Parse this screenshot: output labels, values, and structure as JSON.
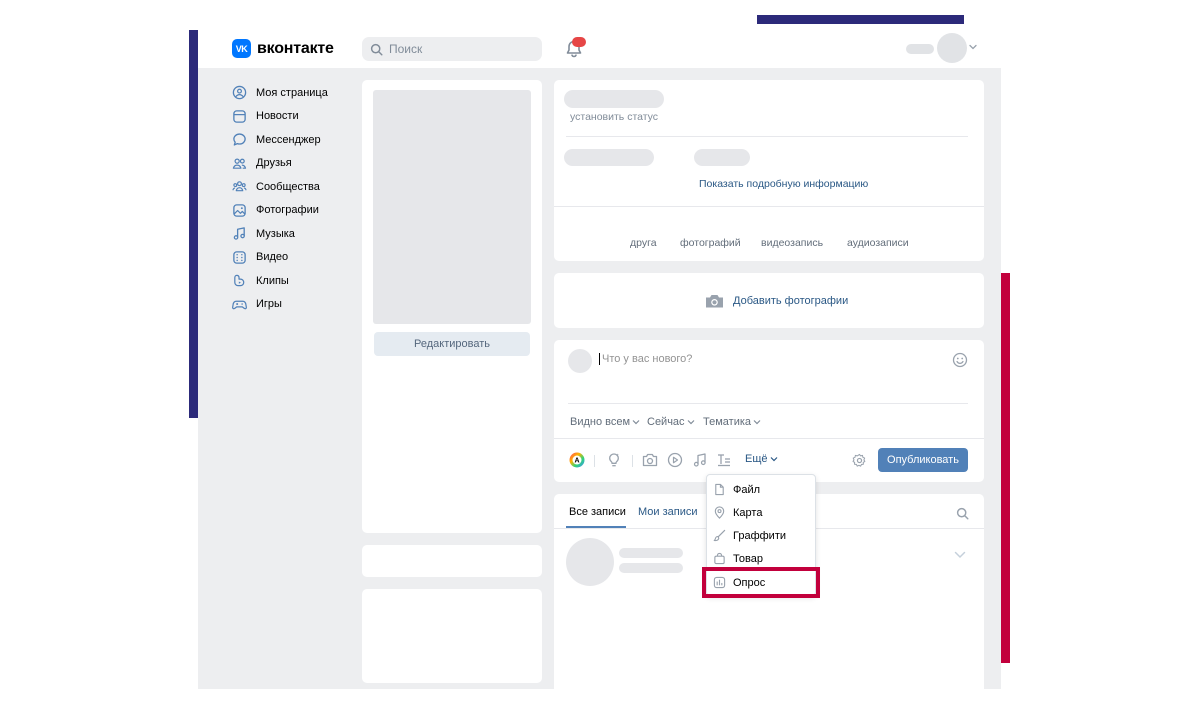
{
  "header": {
    "logo_mark": "VK",
    "logo_text": "вконтакте",
    "search_placeholder": "Поиск"
  },
  "sidebar": {
    "items": [
      {
        "label": "Моя страница",
        "icon": "user-circle-icon"
      },
      {
        "label": "Новости",
        "icon": "news-icon"
      },
      {
        "label": "Мессенджер",
        "icon": "message-icon"
      },
      {
        "label": "Друзья",
        "icon": "friends-icon"
      },
      {
        "label": "Сообщества",
        "icon": "communities-icon"
      },
      {
        "label": "Фотографии",
        "icon": "photos-icon"
      },
      {
        "label": "Музыка",
        "icon": "music-icon"
      },
      {
        "label": "Видео",
        "icon": "video-icon"
      },
      {
        "label": "Клипы",
        "icon": "clips-icon"
      },
      {
        "label": "Игры",
        "icon": "games-icon"
      }
    ]
  },
  "profile_photo": {
    "edit_label": "Редактировать"
  },
  "profile_info": {
    "status_placeholder": "установить статус",
    "show_details": "Показать подробную информацию",
    "counters": [
      "друга",
      "фотографий",
      "видеозапись",
      "аудиозаписи"
    ]
  },
  "photos_block": {
    "add_label": "Добавить фотографии"
  },
  "composer": {
    "placeholder": "Что у вас нового?",
    "visibility": "Видно всем",
    "time": "Сейчас",
    "topic": "Тематика",
    "more": "Ещё",
    "publish": "Опубликовать"
  },
  "attach_menu": {
    "items": [
      {
        "label": "Файл",
        "icon": "file-icon"
      },
      {
        "label": "Карта",
        "icon": "map-pin-icon"
      },
      {
        "label": "Граффити",
        "icon": "brush-icon"
      },
      {
        "label": "Товар",
        "icon": "bag-icon"
      },
      {
        "label": "Опрос",
        "icon": "poll-icon"
      }
    ],
    "highlighted": "Опрос"
  },
  "wall": {
    "tabs": [
      "Все записи",
      "Мои записи"
    ],
    "active_tab": "Все записи"
  },
  "colors": {
    "brand": "#0077ff",
    "accent": "#5181b8",
    "link": "#2a5885",
    "highlight": "#c2003c",
    "decor_navy": "#2c2a7a"
  }
}
